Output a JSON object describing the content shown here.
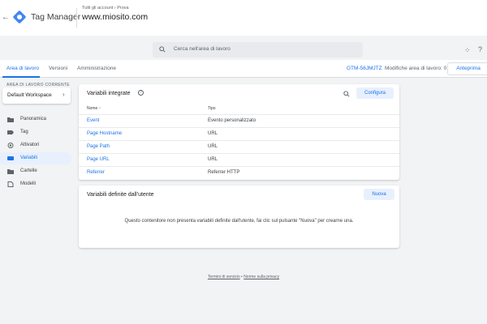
{
  "header": {
    "app_title": "Tag Manager",
    "breadcrumb": "Tutti gli account › Prova",
    "container_name": "www.miosito.com",
    "search_placeholder": "Cerca nell'area di lavoro"
  },
  "subnav": {
    "tabs": [
      {
        "label": "Area di lavoro",
        "active": true
      },
      {
        "label": "Versioni",
        "active": false
      },
      {
        "label": "Amministrazione",
        "active": false
      }
    ],
    "workspace_id": "GTM-56JMJTZ",
    "workspace_changes": "Modifiche area di lavoro: 0",
    "approve_label": "Anteprima"
  },
  "sidebar": {
    "workspace_label": "AREA DI LAVORO CORRENTE",
    "workspace_value": "Default Workspace",
    "items": [
      {
        "label": "Panoramica",
        "icon": "folder-icon",
        "active": false
      },
      {
        "label": "Tag",
        "icon": "tag-icon",
        "active": false
      },
      {
        "label": "Attivatori",
        "icon": "trigger-icon",
        "active": false
      },
      {
        "label": "Variabili",
        "icon": "variable-icon",
        "active": true
      },
      {
        "label": "Cartelle",
        "icon": "folder-icon",
        "active": false
      },
      {
        "label": "Modelli",
        "icon": "template-icon",
        "active": false
      }
    ]
  },
  "builtin": {
    "title": "Variabili integrate",
    "configure_label": "Configura",
    "col_name": "Nome ↑",
    "col_type": "Tipo",
    "rows": [
      {
        "name": "Event",
        "type": "Evento personalizzato"
      },
      {
        "name": "Page Hostname",
        "type": "URL"
      },
      {
        "name": "Page Path",
        "type": "URL"
      },
      {
        "name": "Page URL",
        "type": "URL"
      },
      {
        "name": "Referrer",
        "type": "Referrer HTTP"
      }
    ]
  },
  "user_defined": {
    "title": "Variabili definite dall'utente",
    "new_label": "Nuova",
    "empty_message": "Questo contenitore non presenta variabili definite dall'utente, fai clic sul pulsante \"Nuova\" per crearne una."
  },
  "footer": {
    "terms": "Termini di servizio",
    "separator": "•",
    "privacy": "Norme sulla privacy"
  },
  "colors": {
    "accent": "#1a73e8",
    "accent_tint": "#e8f0fe",
    "background": "#f1f3f4"
  }
}
